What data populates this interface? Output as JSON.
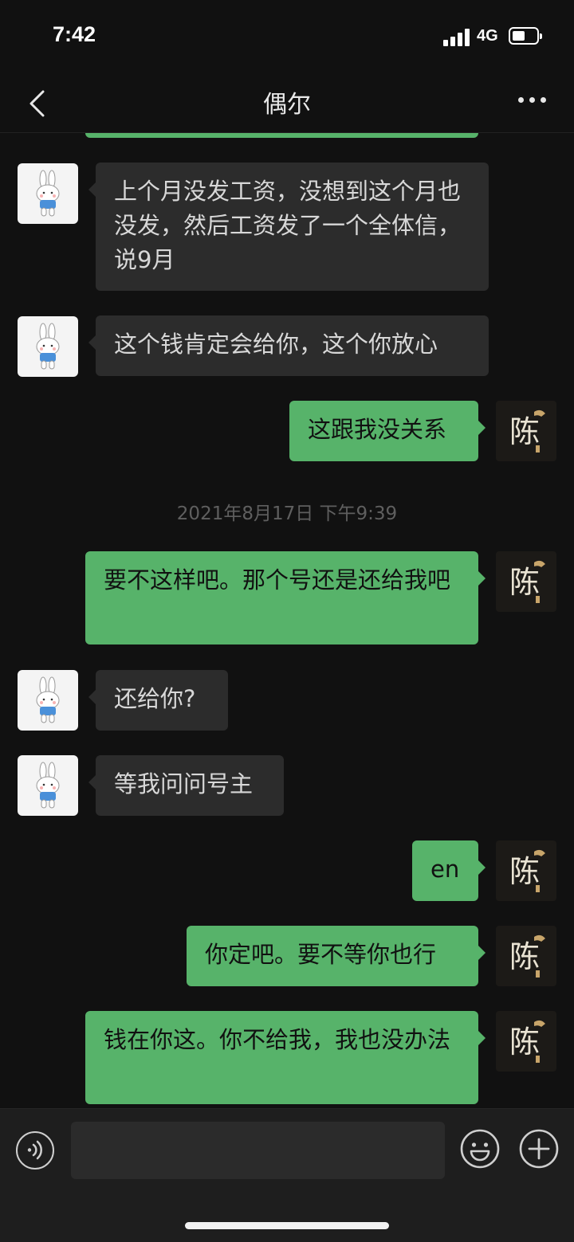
{
  "status_bar": {
    "time": "7:42",
    "network": "4G"
  },
  "header": {
    "title": "偶尔"
  },
  "messages": [
    {
      "side": "in",
      "text": "上个月没发工资，没想到这个月也没发，然后工资发了一个全体信，说9月"
    },
    {
      "side": "in",
      "text": "这个钱肯定会给你，这个你放心"
    },
    {
      "side": "out",
      "text": "这跟我没关系"
    },
    {
      "side": "out",
      "text": "要不这样吧。那个号还是还给我吧"
    },
    {
      "side": "in",
      "text": "还给你?"
    },
    {
      "side": "in",
      "text": "等我问问号主"
    },
    {
      "side": "out",
      "text": "en"
    },
    {
      "side": "out",
      "text": "你定吧。要不等你也行"
    },
    {
      "side": "out",
      "text": "钱在你这。你不给我，我也没办法"
    }
  ],
  "timestamp": "2021年8月17日 下午9:39",
  "avatars": {
    "self_glyph": "陈"
  },
  "input_bar": {
    "placeholder": ""
  },
  "colors": {
    "out_bubble": "#57b36a",
    "in_bubble": "#2c2c2c",
    "background": "#111111"
  },
  "icons": [
    "back-icon",
    "more-icon",
    "rabbit-avatar",
    "voice-icon",
    "emoji-icon",
    "plus-icon"
  ]
}
